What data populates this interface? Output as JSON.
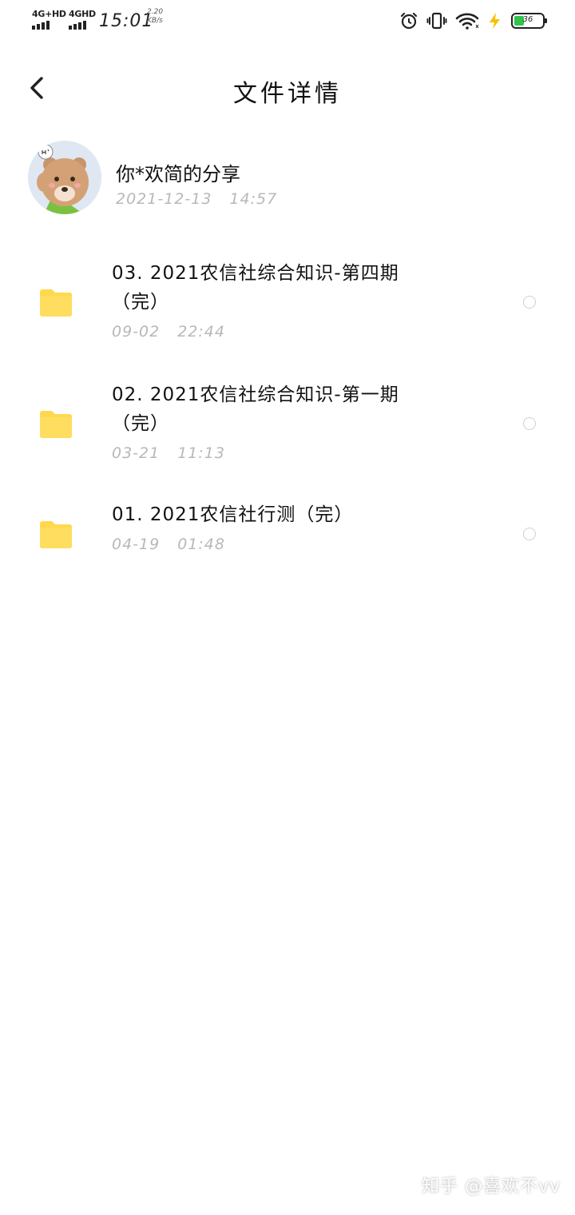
{
  "status_bar": {
    "signal1_label": "4G+HD",
    "signal2_label": "4GHD",
    "time": "15:01",
    "net_speed": "2.20",
    "net_unit": "KB/s",
    "battery_level": "36",
    "icons": [
      "alarm-icon",
      "vibrate-icon",
      "wifi-icon",
      "charging-icon",
      "battery-icon"
    ]
  },
  "header": {
    "title": "文件详情",
    "back_icon": "chevron-left-icon"
  },
  "sharer": {
    "name": "你*欢简的分享",
    "date": "2021-12-13",
    "time": "14:57"
  },
  "files": [
    {
      "name": "03. 2021农信社综合知识-第四期（完）",
      "date": "09-02",
      "time": "22:44",
      "icon": "folder-icon"
    },
    {
      "name": "02. 2021农信社综合知识-第一期（完）",
      "date": "03-21",
      "time": "11:13",
      "icon": "folder-icon"
    },
    {
      "name": "01. 2021农信社行测（完）",
      "date": "04-19",
      "time": "01:48",
      "icon": "folder-icon"
    }
  ],
  "watermark": "知乎 @喜欢不vv",
  "colors": {
    "folder": "#FFD84D",
    "meta_text": "#B8B8B8",
    "battery_fill": "#32C24D"
  }
}
